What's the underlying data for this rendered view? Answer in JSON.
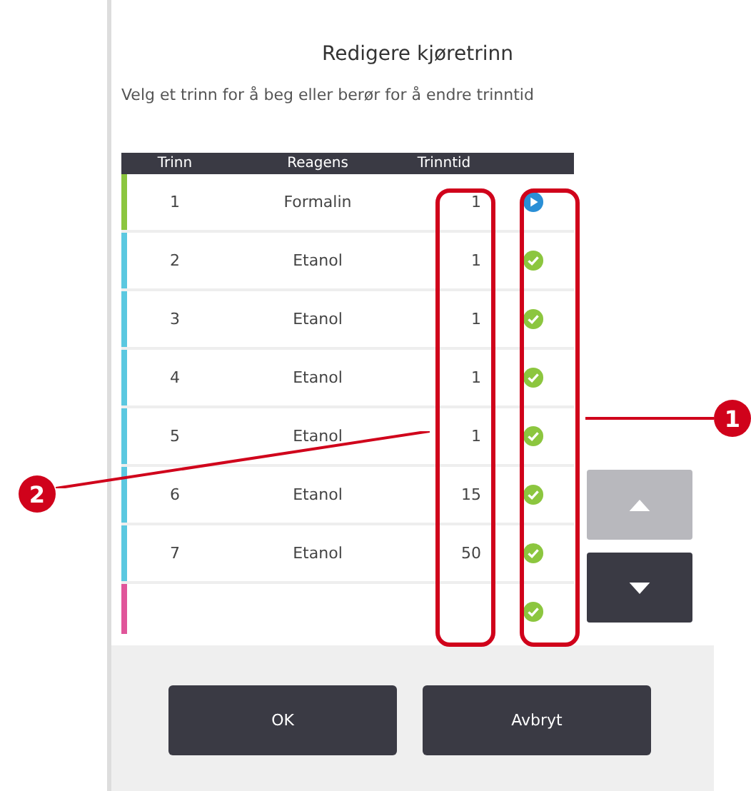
{
  "dialog": {
    "title": "Redigere kjøretrinn",
    "instruction": "Velg et trinn for å beg eller berør for å endre trinntid"
  },
  "table": {
    "columns": [
      "Trinn",
      "Reagens",
      "Trinntid"
    ],
    "rows": [
      {
        "step": "1",
        "reagent": "Formalin",
        "time": "1",
        "current": true,
        "color": "#8cc63f"
      },
      {
        "step": "2",
        "reagent": "Etanol",
        "time": "1",
        "current": false,
        "color": "#5bc8e0"
      },
      {
        "step": "3",
        "reagent": "Etanol",
        "time": "1",
        "current": false,
        "color": "#5bc8e0"
      },
      {
        "step": "4",
        "reagent": "Etanol",
        "time": "1",
        "current": false,
        "color": "#5bc8e0"
      },
      {
        "step": "5",
        "reagent": "Etanol",
        "time": "1",
        "current": false,
        "color": "#5bc8e0"
      },
      {
        "step": "6",
        "reagent": "Etanol",
        "time": "15",
        "current": false,
        "color": "#5bc8e0"
      },
      {
        "step": "7",
        "reagent": "Etanol",
        "time": "50",
        "current": false,
        "color": "#5bc8e0"
      },
      {
        "current": false,
        "color": "#e0559a"
      }
    ]
  },
  "scroll": {
    "up_disabled": true,
    "down_disabled": false
  },
  "buttons": [
    "OK",
    "Avbryt"
  ],
  "callouts": [
    {
      "label": "1"
    },
    {
      "label": "2"
    }
  ]
}
